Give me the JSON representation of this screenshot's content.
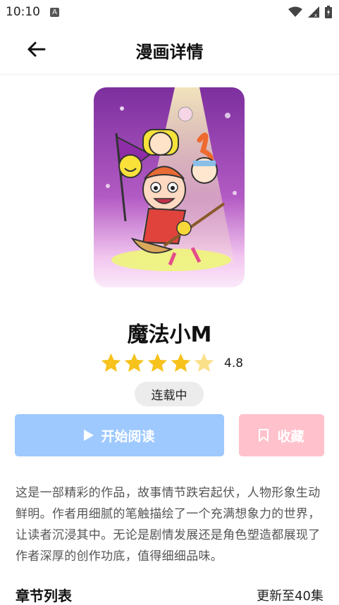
{
  "status_bar": {
    "time": "10:10",
    "notification_icon": "a-app-icon",
    "icons": [
      "wifi-icon",
      "signal-icon",
      "battery-icon"
    ]
  },
  "app_bar": {
    "title": "漫画详情",
    "back_icon": "arrow-left-icon"
  },
  "comic": {
    "name": "魔法小M",
    "rating_value": 4.8,
    "rating_text": "4.8",
    "stars_filled": 4,
    "stars_total": 5,
    "status": "连载中",
    "description": "这是一部精彩的作品，故事情节跌宕起伏，人物形象生动鲜明。作者用细腻的笔触描绘了一个充满想象力的世界，让读者沉浸其中。无论是剧情发展还是角色塑造都展现了作者深厚的创作功底，值得细细品味。"
  },
  "actions": {
    "read_label": "开始阅读",
    "favorite_label": "收藏"
  },
  "chapters": {
    "title": "章节列表",
    "update_text": "更新至40集"
  },
  "colors": {
    "read_button": "#9ec9ff",
    "favorite_button": "#ffc2cc",
    "star": "#f7c21b",
    "star_partial": "#fbe08a"
  }
}
